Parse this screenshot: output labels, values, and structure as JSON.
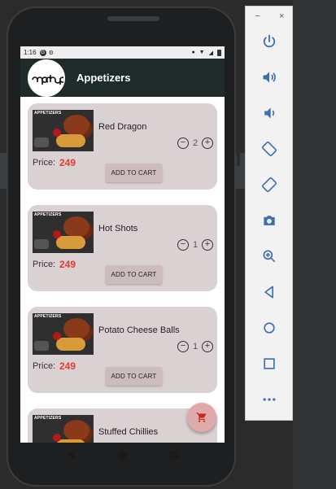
{
  "status_bar": {
    "time": "1:16"
  },
  "app_bar": {
    "title": "Appetizers",
    "logo_text": "aap ahup"
  },
  "thumbnail_tag": "APPETIZERS",
  "items": [
    {
      "name": "Red Dragon",
      "price_label": "Price:",
      "price": "249",
      "quantity": "2",
      "add_label": "ADD TO CART"
    },
    {
      "name": "Hot Shots",
      "price_label": "Price:",
      "price": "249",
      "quantity": "1",
      "add_label": "ADD TO CART"
    },
    {
      "name": "Potato Cheese Balls",
      "price_label": "Price:",
      "price": "249",
      "quantity": "1",
      "add_label": "ADD TO CART"
    },
    {
      "name": "Stuffed Chillies"
    }
  ],
  "fab": {
    "icon": "cart-icon"
  },
  "emulator": {
    "window_controls": [
      "−",
      "×"
    ],
    "tools": [
      "power-icon",
      "volume-up-icon",
      "volume-down-icon",
      "rotate-left-icon",
      "rotate-right-icon",
      "camera-icon",
      "zoom-icon",
      "back-icon",
      "home-icon",
      "overview-icon",
      "more-icon"
    ]
  },
  "colors": {
    "appbar": "#1f2a2a",
    "card": "#dad2d2",
    "price": "#e53935",
    "fab": "#e0aaaa",
    "emulator_icon": "#3f6fb0"
  }
}
